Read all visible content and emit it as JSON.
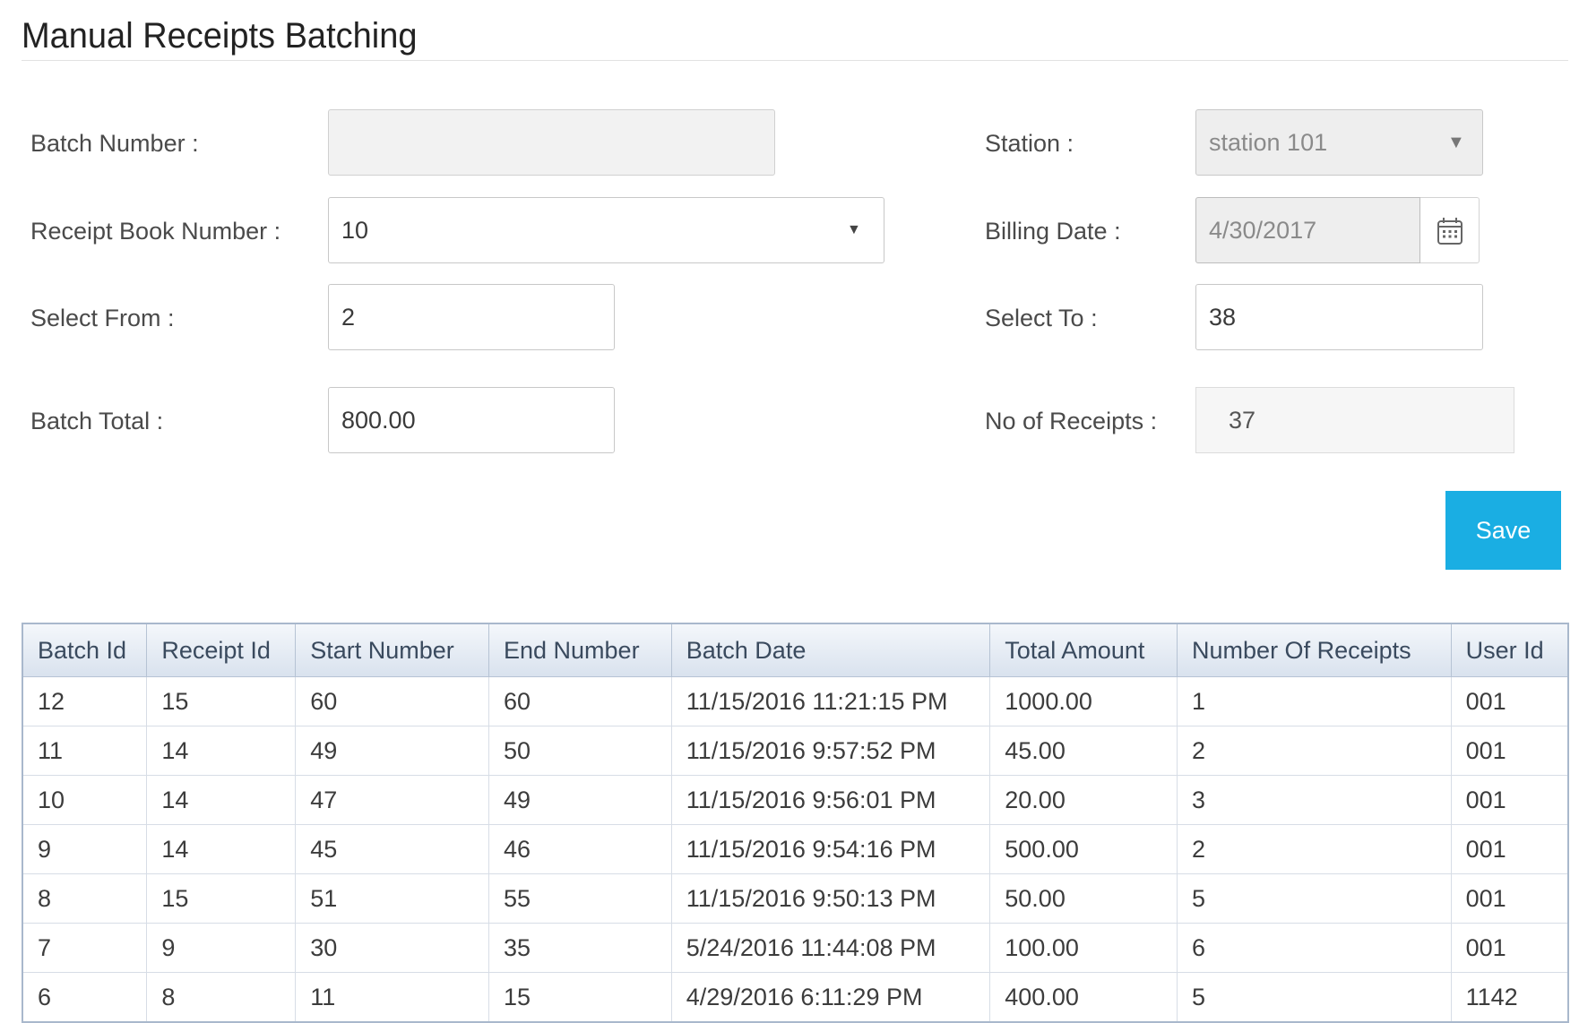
{
  "page": {
    "title": "Manual Receipts Batching"
  },
  "form": {
    "batch_number": {
      "label": "Batch Number :",
      "value": ""
    },
    "station": {
      "label": "Station :",
      "value": "station 101"
    },
    "receipt_book_number": {
      "label": "Receipt Book Number :",
      "value": "10"
    },
    "billing_date": {
      "label": "Billing Date :",
      "value": "4/30/2017"
    },
    "select_from": {
      "label": "Select From :",
      "value": "2"
    },
    "select_to": {
      "label": "Select To :",
      "value": "38"
    },
    "batch_total": {
      "label": "Batch Total :",
      "value": "800.00"
    },
    "no_of_receipts": {
      "label": "No of Receipts :",
      "value": "37"
    },
    "save_label": "Save",
    "dropdown_caret": "▼"
  },
  "table": {
    "headers": [
      "Batch Id",
      "Receipt Id",
      "Start Number",
      "End Number",
      "Batch Date",
      "Total Amount",
      "Number Of Receipts",
      "User Id"
    ],
    "rows": [
      [
        "12",
        "15",
        "60",
        "60",
        "11/15/2016 11:21:15 PM",
        "1000.00",
        "1",
        "001"
      ],
      [
        "11",
        "14",
        "49",
        "50",
        "11/15/2016 9:57:52 PM",
        "45.00",
        "2",
        "001"
      ],
      [
        "10",
        "14",
        "47",
        "49",
        "11/15/2016 9:56:01 PM",
        "20.00",
        "3",
        "001"
      ],
      [
        "9",
        "14",
        "45",
        "46",
        "11/15/2016 9:54:16 PM",
        "500.00",
        "2",
        "001"
      ],
      [
        "8",
        "15",
        "51",
        "55",
        "11/15/2016 9:50:13 PM",
        "50.00",
        "5",
        "001"
      ],
      [
        "7",
        "9",
        "30",
        "35",
        "5/24/2016 11:44:08 PM",
        "100.00",
        "6",
        "001"
      ],
      [
        "6",
        "8",
        "11",
        "15",
        "4/29/2016 6:11:29 PM",
        "400.00",
        "5",
        "1142"
      ]
    ]
  },
  "colors": {
    "accent": "#1aaee3",
    "header_border": "#a9b8cc"
  },
  "icons": {
    "calendar": "calendar-icon",
    "dropdown": "chevron-down-icon"
  }
}
